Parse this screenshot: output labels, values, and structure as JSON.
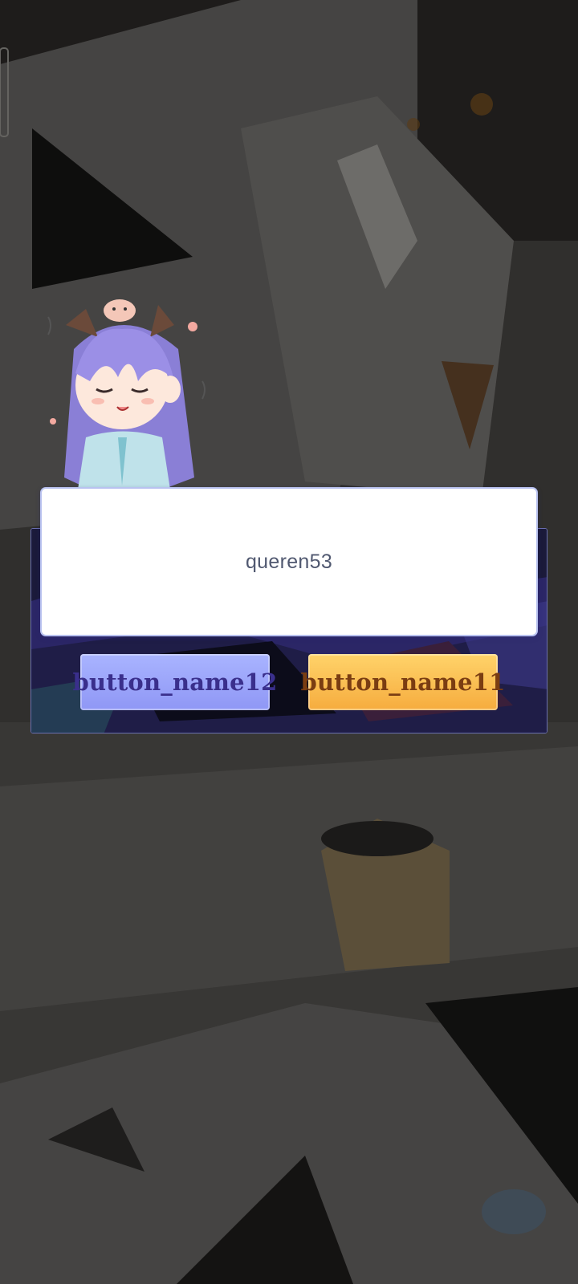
{
  "dialog": {
    "message": "queren53",
    "buttons": {
      "left_label": "button_name12",
      "right_label": "button_name11"
    }
  },
  "mascot": {
    "icon": "chibi-girl-mascot-icon"
  },
  "colors": {
    "left_button": "#9ea8fb",
    "right_button": "#fbbd4f",
    "dialog_frame": "#16162e",
    "message_box": "#ffffff",
    "message_text": "#505870"
  }
}
